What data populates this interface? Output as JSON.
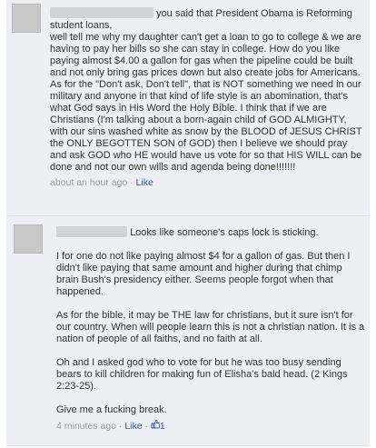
{
  "comment1": {
    "lead": "you said that President Obama is Reforming student loans,",
    "text": "well tell me why my daughter can't get a loan to go to college & we are having to pay her bills so she can stay in college. How do you like paying almost $4.00 a gallon for gas when the pipeline could be built and not only bring gas prices down but also create jobs for Americans. As for the \"Don't ask, Don't tell\", that is NOT something we need in our military and anyone in that kind of life style is an abomination, that's what God says in His Word the Holy Bible. I think that if we are Christians (I'm talking about a born-again child of GOD ALMIGHTY, with our sins washed white as snow by the BLOOD of JESUS CHRIST the ONLY BEGOTTEN SON of GOD) then I believe we should pray and ask GOD who HE would have us vote for so that HIS WILL can be done and not our own wills and agenda being done!!!!!!!",
    "time": "about an hour ago",
    "separator": " · ",
    "like_label": "Like"
  },
  "comment2": {
    "lead": "Looks like someone's caps lock is sticking.",
    "paragraphs": [
      "I for one do not like paying almost $4 for a gallon of gas. But then I didn't like paying that same amount and higher during that chimp brain Bush's presidency either. Seems people forgot when that happened.",
      "As for the bible, it may be THE law for christians, but it sure isn't for our country. When will people learn this is not a christian nation. It is a nation of people of all faiths, and no faith at all.",
      "Oh and I asked god who to vote for but he was too busy sending bears to kill children for making fun of Elisha's bald head. (2 Kings 2:23-25).",
      "Give me a fucking break."
    ],
    "time": "4 minutes ago",
    "separator": " · ",
    "like_label": "Like",
    "separator2": " · ",
    "like_icon": "thumbs-up-icon",
    "like_count": "1"
  },
  "colors": {
    "comment_bg": "#edeff4",
    "link": "#3b5998",
    "meta": "#999999",
    "text": "#333333"
  }
}
